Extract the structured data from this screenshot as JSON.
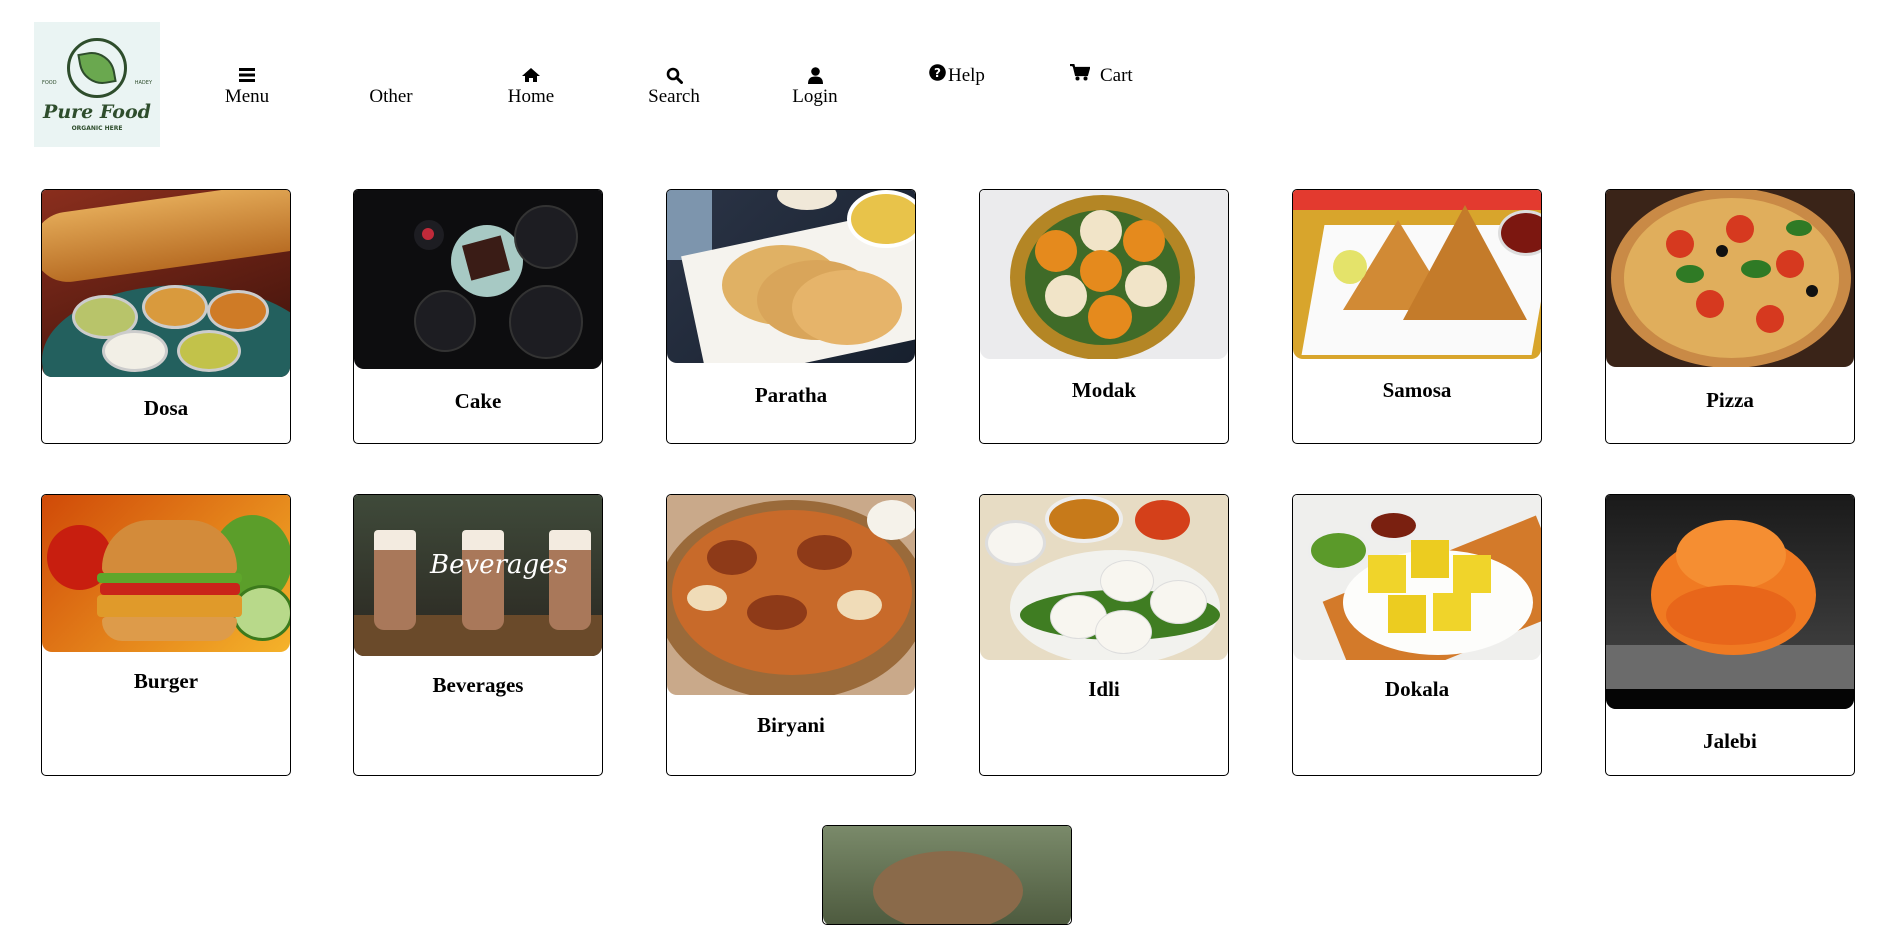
{
  "logo": {
    "brand": "Pure Food",
    "left_text": "FOOD",
    "right_text": "HADEY",
    "tagline": "ORGANIC HERE"
  },
  "nav": {
    "menu": {
      "label": "Menu",
      "icon": "bars-icon"
    },
    "other": {
      "label": "Other"
    },
    "home": {
      "label": "Home",
      "icon": "home-icon"
    },
    "search": {
      "label": "Search",
      "icon": "search-icon"
    },
    "login": {
      "label": "Login",
      "icon": "user-icon"
    },
    "help": {
      "label": "Help",
      "icon": "question-circle-icon"
    },
    "cart": {
      "label": "Cart",
      "icon": "cart-icon"
    }
  },
  "products": [
    {
      "name": "Dosa"
    },
    {
      "name": "Cake"
    },
    {
      "name": "Paratha"
    },
    {
      "name": "Modak"
    },
    {
      "name": "Samosa"
    },
    {
      "name": "Pizza"
    },
    {
      "name": "Burger"
    },
    {
      "name": "Beverages",
      "overlay_text": "Beverages"
    },
    {
      "name": "Biryani"
    },
    {
      "name": "Idli"
    },
    {
      "name": "Dokala"
    },
    {
      "name": "Jalebi"
    }
  ]
}
